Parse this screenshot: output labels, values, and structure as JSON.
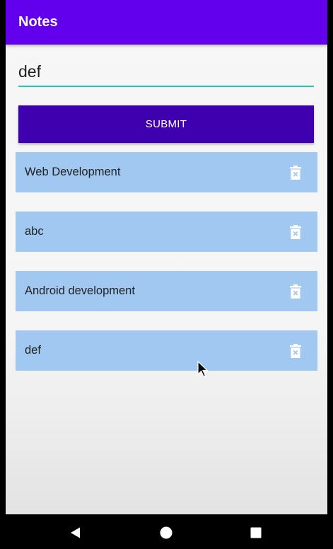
{
  "app_bar": {
    "title": "Notes",
    "color": "#6200ee"
  },
  "input": {
    "value": "def",
    "underline_color": "#26c6b5"
  },
  "submit": {
    "label": "SUBMIT",
    "color": "#3f00b0"
  },
  "notes": [
    {
      "text": "Web Development",
      "icon": "delete-icon"
    },
    {
      "text": "abc",
      "icon": "delete-icon"
    },
    {
      "text": "Android development",
      "icon": "delete-icon"
    },
    {
      "text": "def",
      "icon": "delete-icon"
    }
  ],
  "note_item_color": "#a0c8f0",
  "nav": {
    "back_icon": "back-triangle-icon",
    "home_icon": "home-circle-icon",
    "recents_icon": "recents-square-icon"
  }
}
